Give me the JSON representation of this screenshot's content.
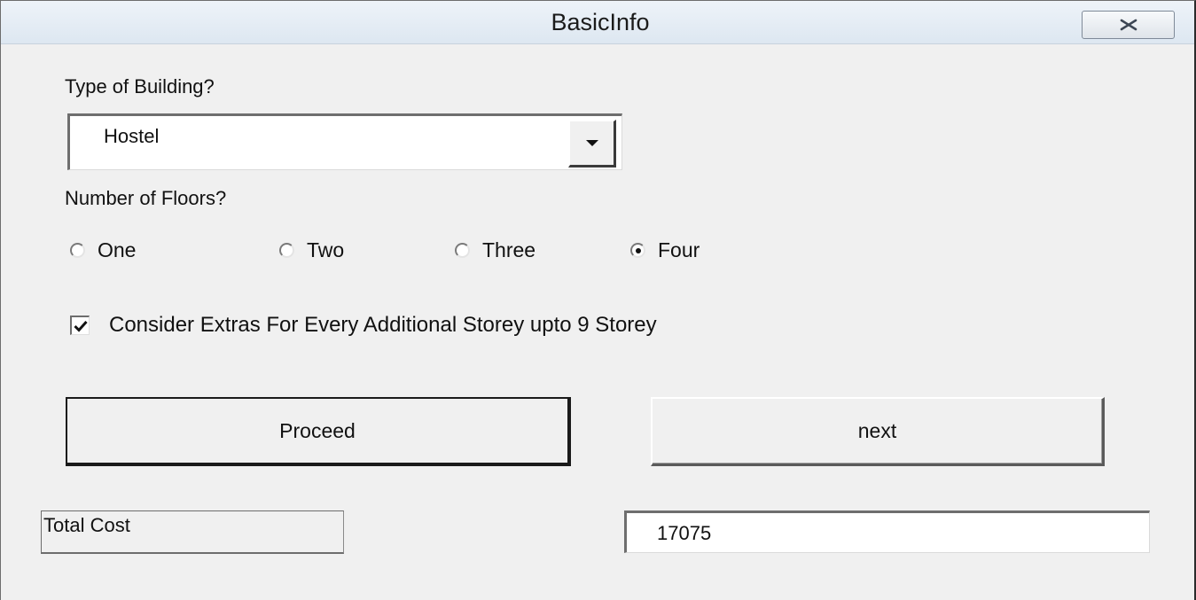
{
  "window": {
    "title": "BasicInfo",
    "close_icon": "close-x-icon"
  },
  "building": {
    "label": "Type of Building?",
    "selected_value": "Hostel"
  },
  "floors": {
    "label": "Number of Floors?",
    "options": [
      {
        "label": "One",
        "checked": false
      },
      {
        "label": "Two",
        "checked": false
      },
      {
        "label": "Three",
        "checked": false
      },
      {
        "label": "Four",
        "checked": true
      }
    ]
  },
  "extras": {
    "label": "Consider Extras For Every Additional Storey upto 9 Storey",
    "checked": true
  },
  "buttons": {
    "proceed": "Proceed",
    "next": "next"
  },
  "total": {
    "label": "Total Cost",
    "value": "17075"
  }
}
